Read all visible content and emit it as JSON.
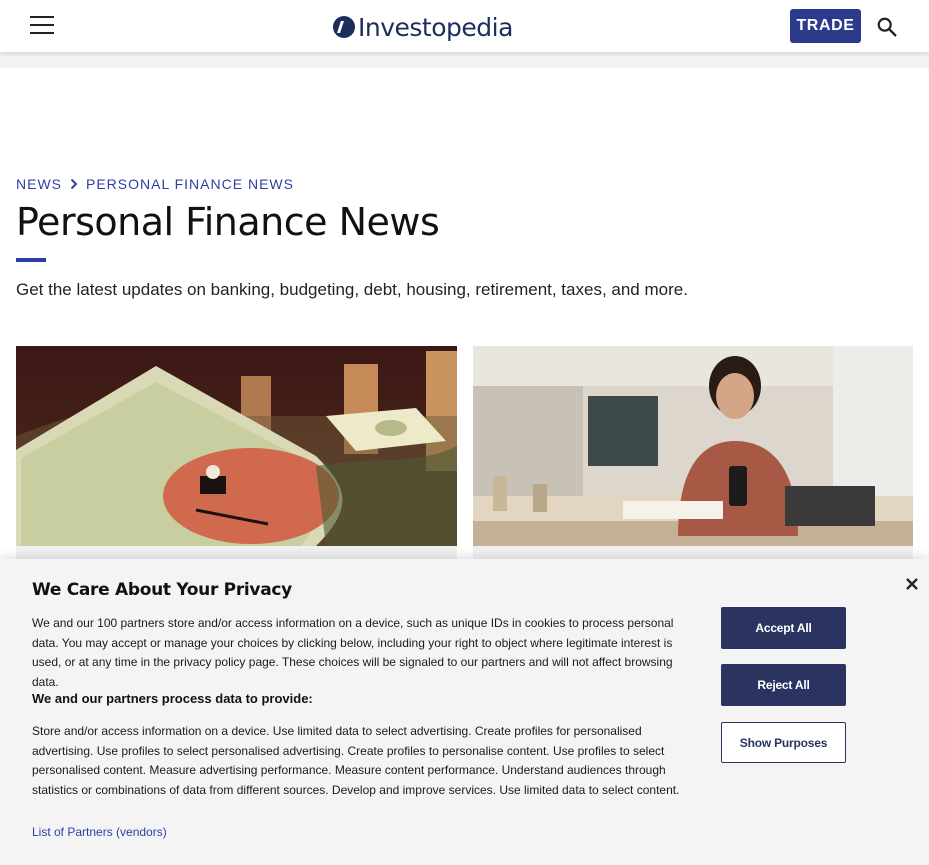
{
  "header": {
    "logo_text": "Investopedia",
    "trade_label": "TRADE"
  },
  "breadcrumb": {
    "items": [
      {
        "label": "NEWS"
      },
      {
        "label": "PERSONAL FINANCE NEWS"
      }
    ]
  },
  "page": {
    "title": "Personal Finance News",
    "subtitle": "Get the latest updates on banking, budgeting, debt, housing, retirement, taxes, and more."
  },
  "privacy": {
    "title": "We Care About Your Privacy",
    "body": "We and our 100 partners store and/or access information on a device, such as unique IDs in cookies to process personal data. You may accept or manage your choices by clicking below, including your right to object where legitimate interest is used, or at any time in the privacy policy page. These choices will be signaled to our partners and will not affect browsing data.",
    "purposes_heading": "We and our partners process data to provide:",
    "purposes_body": "Store and/or access information on a device. Use limited data to select advertising. Create profiles for personalised advertising. Use profiles to select personalised advertising. Create profiles to personalise content. Use profiles to select personalised content. Measure advertising performance. Measure content performance. Understand audiences through statistics or combinations of data from different sources. Develop and improve services. Use limited data to select content.",
    "partners_link": "List of Partners (vendors)",
    "accept_label": "Accept All",
    "reject_label": "Reject All",
    "purposes_label": "Show Purposes"
  },
  "icons": {
    "menu": "hamburger-menu-icon",
    "search": "search-icon",
    "chevron": "chevron-right-icon",
    "close": "close-icon"
  },
  "colors": {
    "brand_navy": "#1c2e5c",
    "trade_button": "#2c3a8c",
    "link_blue": "#2d3ea8",
    "consent_button": "#2b3461"
  }
}
